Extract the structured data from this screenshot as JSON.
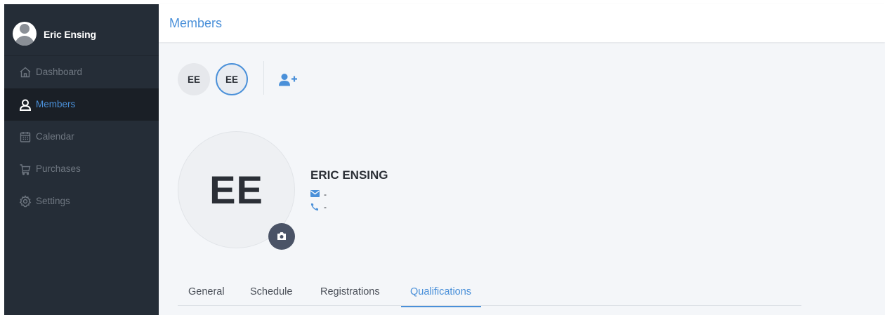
{
  "user": {
    "name": "Eric Ensing"
  },
  "nav": {
    "items": [
      {
        "label": "Dashboard",
        "icon": "home-icon",
        "active": false
      },
      {
        "label": "Members",
        "icon": "user-icon",
        "active": true
      },
      {
        "label": "Calendar",
        "icon": "calendar-icon",
        "active": false
      },
      {
        "label": "Purchases",
        "icon": "cart-icon",
        "active": false
      },
      {
        "label": "Settings",
        "icon": "gear-icon",
        "active": false
      }
    ]
  },
  "header": {
    "title": "Members"
  },
  "member_chips": [
    {
      "initials": "EE",
      "selected": false
    },
    {
      "initials": "EE",
      "selected": true
    }
  ],
  "profile": {
    "initials": "EE",
    "name": "ERIC ENSING",
    "email": "-",
    "phone": "-"
  },
  "tabs": [
    {
      "label": "General",
      "active": false
    },
    {
      "label": "Schedule",
      "active": false
    },
    {
      "label": "Registrations",
      "active": false
    },
    {
      "label": "Qualifications",
      "active": true
    }
  ],
  "colors": {
    "accent": "#4a90d9",
    "sidebar": "#252d37",
    "sidebar_active": "#1a1f26",
    "content_bg": "#f4f6f9"
  }
}
